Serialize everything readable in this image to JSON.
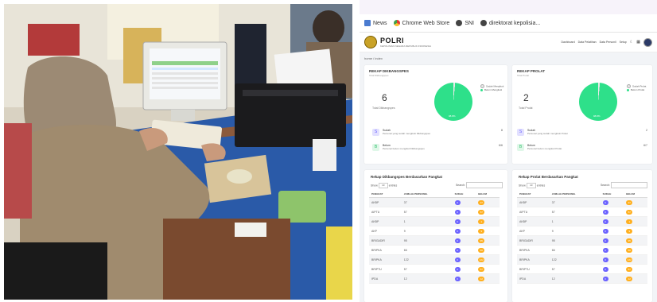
{
  "bookmarks": [
    {
      "label": "News",
      "icon": "news-icon"
    },
    {
      "label": "Chrome Web Store",
      "icon": "chrome-web-store-icon"
    },
    {
      "label": "SNI",
      "icon": "globe-icon"
    },
    {
      "label": "direktorat kepolisia...",
      "icon": "globe-icon"
    }
  ],
  "header": {
    "logo_text": "POLRI",
    "logo_sub": "KEPOLISIAN NEGARA REPUBLIK INDONESIA",
    "nav": [
      "Dashboard",
      "Data Pelatihan",
      "Data Personil",
      "Setup"
    ]
  },
  "breadcrumb": "home / index",
  "rekap_dikbangspes": {
    "title": "REKAP DIKBANGSPES",
    "subtitle": "Total Dikbangspes",
    "total": "6",
    "total_label": "Total Dikbangspes",
    "legend": [
      "Sudah Mengikuti",
      "Belum Mengikuti"
    ],
    "pie_label": "98.8%",
    "pie_sudah_pct": 1.5,
    "stats": [
      {
        "letter": "S",
        "name": "Sudah",
        "desc": "Personel yang sudah mengikuti Dikbangspes",
        "value": "8"
      },
      {
        "letter": "B",
        "name": "Belum",
        "desc": "Personel belum mengikuti Dikbangspes",
        "value": "6/6"
      }
    ]
  },
  "rekap_prolat": {
    "title": "REKAP PROLAT",
    "subtitle": "Total Prolat",
    "total": "2",
    "total_label": "Total Prolat",
    "legend": [
      "Sudah Prolat",
      "Belum Prolat"
    ],
    "pie_label": "98.8%",
    "pie_sudah_pct": 1.5,
    "stats": [
      {
        "letter": "S",
        "name": "Sudah",
        "desc": "Personel yang sudah mengikuti Prolat",
        "value": "2"
      },
      {
        "letter": "B",
        "name": "Belum",
        "desc": "Personel belum mengikuti Prolat",
        "value": "6/7"
      }
    ]
  },
  "table_dikbangspes": {
    "title": "Rekap Dikbangspes Berdasarkan Pangkat",
    "show_label": "Show",
    "entries_value": "10",
    "entries_label": "entries",
    "search_label": "Search:",
    "columns": [
      "PANGKAT",
      "JUMLAH PERSONEL",
      "SUDAH",
      "BELUM"
    ],
    "rows": [
      [
        "AKBP",
        "37",
        "0",
        "37"
      ],
      [
        "AIPTU",
        "57",
        "0",
        "57"
      ],
      [
        "AKBP",
        "1",
        "0",
        "1"
      ],
      [
        "AKP",
        "9",
        "0",
        "9"
      ],
      [
        "BRIGADIR",
        "95",
        "0",
        "95"
      ],
      [
        "BRIPKA",
        "66",
        "0",
        "66"
      ],
      [
        "BRIPKA",
        "122",
        "0",
        "122"
      ],
      [
        "BRIPTU",
        "57",
        "0",
        "57"
      ],
      [
        "IPDA",
        "12",
        "0",
        "12"
      ]
    ]
  },
  "table_prolat": {
    "title": "Rekap Prolat Berdasarkan Pangkat",
    "show_label": "Show",
    "entries_value": "10",
    "entries_label": "entries",
    "search_label": "Search:",
    "columns": [
      "PANGKAT",
      "JUMLAH PERSONEL",
      "SUDAH",
      "BELUM"
    ],
    "rows": [
      [
        "AKBP",
        "37",
        "0",
        "37"
      ],
      [
        "AIPTU",
        "57",
        "0",
        "57"
      ],
      [
        "AKBP",
        "1",
        "0",
        "1"
      ],
      [
        "AKP",
        "9",
        "0",
        "9"
      ],
      [
        "BRIGADIR",
        "95",
        "0",
        "95"
      ],
      [
        "BRIPKA",
        "66",
        "0",
        "66"
      ],
      [
        "BRIPKA",
        "122",
        "0",
        "122"
      ],
      [
        "BRIPTU",
        "57",
        "0",
        "57"
      ],
      [
        "IPDA",
        "12",
        "0",
        "12"
      ]
    ]
  },
  "colors": {
    "pie_green": "#2ee08a",
    "badge_purple": "#6c63ff",
    "badge_orange": "#ffb020"
  }
}
